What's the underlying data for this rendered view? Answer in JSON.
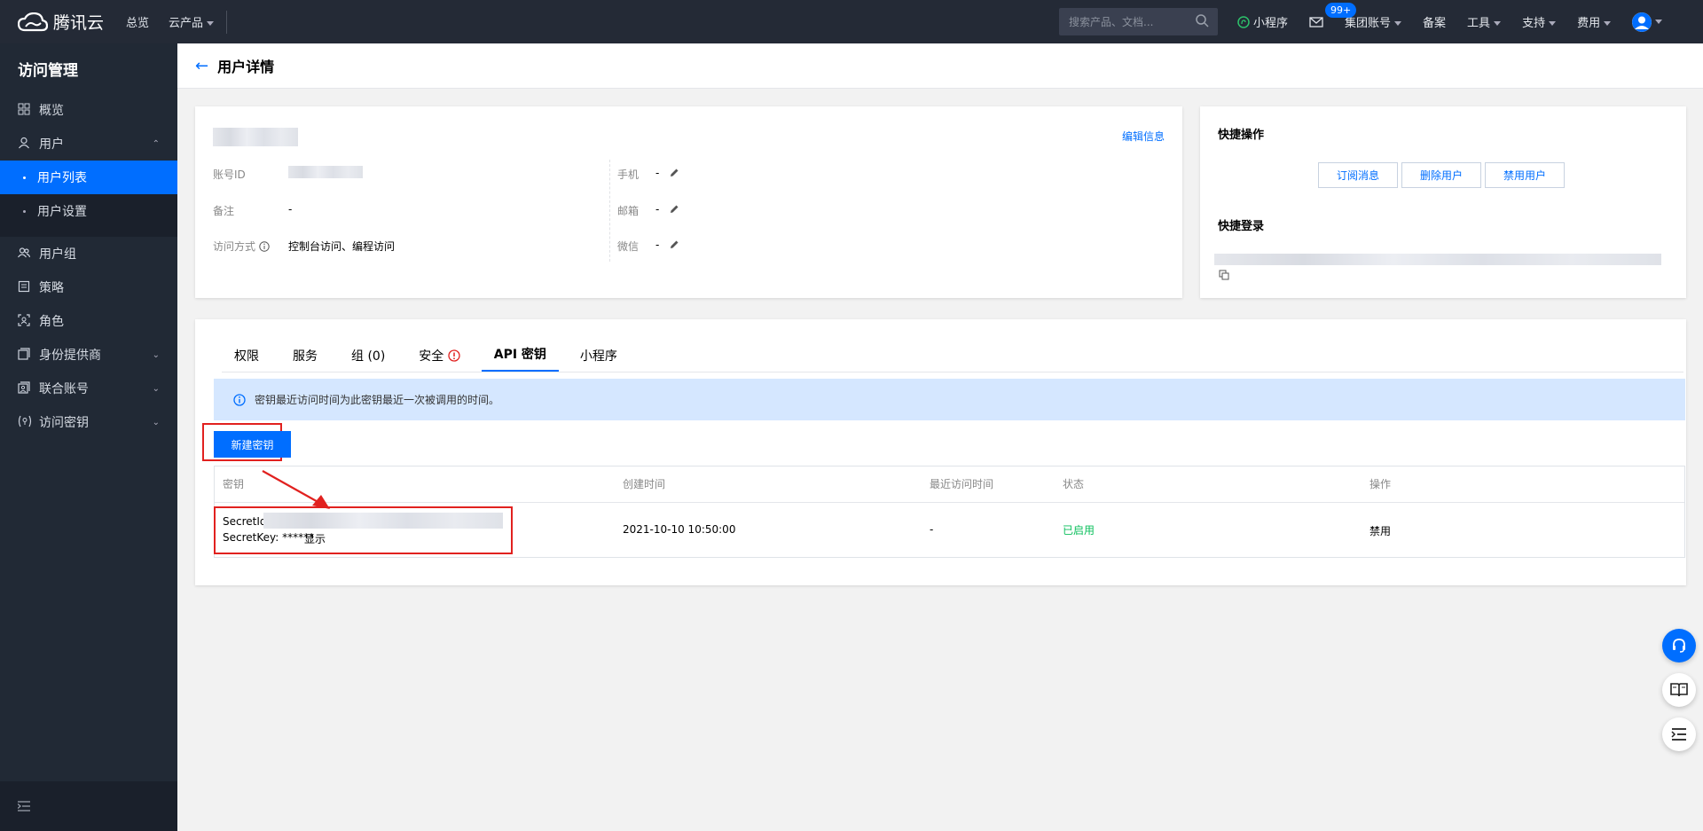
{
  "brand": {
    "name": "腾讯云"
  },
  "topnav": {
    "overview": "总览",
    "products": "云产品"
  },
  "search": {
    "placeholder": "搜索产品、文档..."
  },
  "topright": {
    "miniprogram": "小程序",
    "badge": "99+",
    "group_account": "集团账号",
    "beian": "备案",
    "tools": "工具",
    "support": "支持",
    "fees": "费用"
  },
  "sidebar": {
    "title": "访问管理",
    "items": [
      {
        "label": "概览"
      },
      {
        "label": "用户"
      },
      {
        "label": "用户列表"
      },
      {
        "label": "用户设置"
      },
      {
        "label": "用户组"
      },
      {
        "label": "策略"
      },
      {
        "label": "角色"
      },
      {
        "label": "身份提供商"
      },
      {
        "label": "联合账号"
      },
      {
        "label": "访问密钥"
      }
    ]
  },
  "page": {
    "title": "用户详情"
  },
  "user_info": {
    "edit_link": "编辑信息",
    "account_id_label": "账号ID",
    "remark_label": "备注",
    "remark_value": "-",
    "access_label": "访问方式",
    "access_value": "控制台访问、编程访问",
    "phone_label": "手机",
    "phone_value": "-",
    "email_label": "邮箱",
    "email_value": "-",
    "wechat_label": "微信",
    "wechat_value": "-"
  },
  "quick": {
    "ops_title": "快捷操作",
    "subscribe": "订阅消息",
    "delete": "删除用户",
    "disable": "禁用用户",
    "login_title": "快捷登录"
  },
  "tabs": [
    {
      "label": "权限"
    },
    {
      "label": "服务"
    },
    {
      "label": "组 (0)"
    },
    {
      "label": "安全"
    },
    {
      "label": "API 密钥"
    },
    {
      "label": "小程序"
    }
  ],
  "active_tab": "API 密钥",
  "notice": "密钥最近访问时间为此密钥最近一次被调用的时间。",
  "new_key_button": "新建密钥",
  "table": {
    "headers": [
      "密钥",
      "创建时间",
      "最近访问时间",
      "状态",
      "操作"
    ],
    "rows": [
      {
        "secret_id_label": "SecretId",
        "secret_key_label": "SecretKey: ******",
        "show": "显示",
        "created": "2021-10-10 10:50:00",
        "last_access": "-",
        "status": "已启用",
        "action": "禁用"
      }
    ]
  },
  "colors": {
    "accent": "#006eff",
    "topbar": "#242a36",
    "sidebar": "#212935",
    "success": "#0abf5b",
    "highlight": "#e1211f"
  }
}
